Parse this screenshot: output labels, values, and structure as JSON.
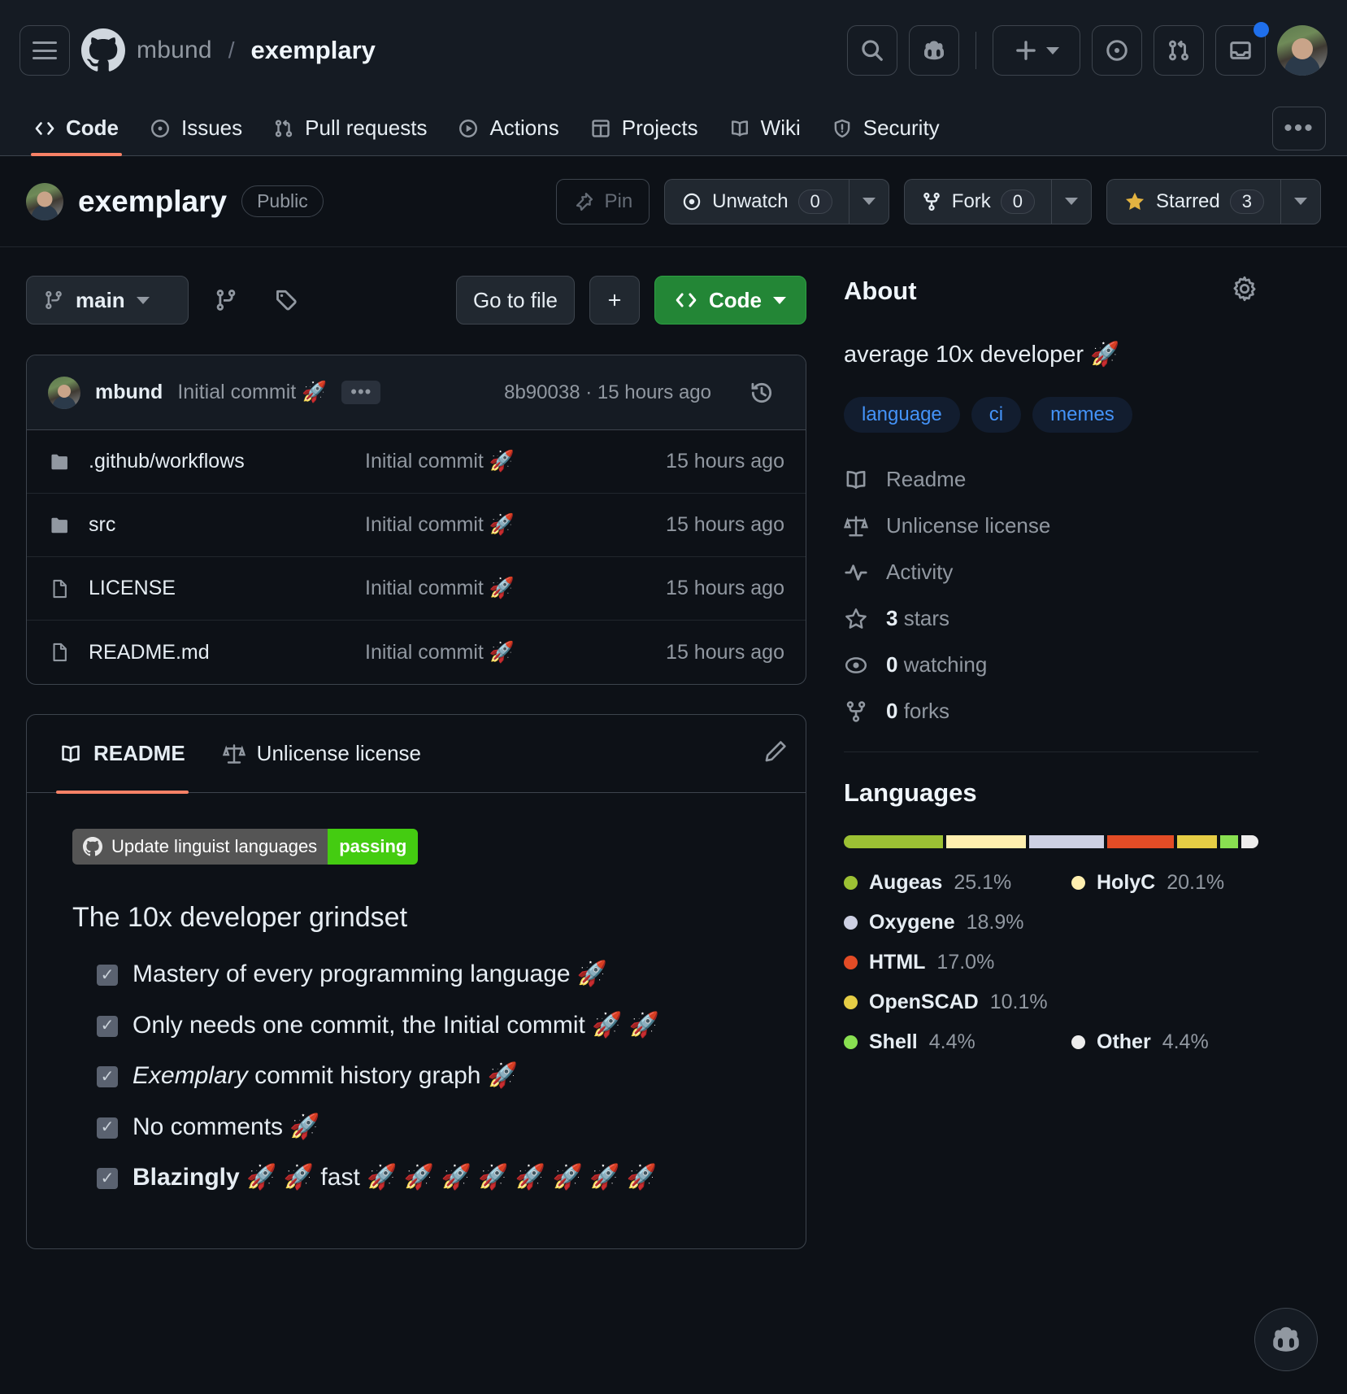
{
  "header": {
    "owner": "mbund",
    "separator": "/",
    "repo": "exemplary",
    "icons": [
      "menu-icon",
      "github-logo",
      "search-icon",
      "copilot-icon",
      "plus-icon",
      "chevron-down-icon",
      "issues-icon",
      "pull-requests-icon",
      "inbox-icon",
      "avatar"
    ]
  },
  "nav": {
    "tabs": [
      {
        "label": "Code",
        "icon": "code-icon",
        "active": true
      },
      {
        "label": "Issues",
        "icon": "issue-opened-icon",
        "active": false
      },
      {
        "label": "Pull requests",
        "icon": "git-pull-request-icon",
        "active": false
      },
      {
        "label": "Actions",
        "icon": "play-icon",
        "active": false
      },
      {
        "label": "Projects",
        "icon": "table-icon",
        "active": false
      },
      {
        "label": "Wiki",
        "icon": "book-icon",
        "active": false
      },
      {
        "label": "Security",
        "icon": "shield-icon",
        "active": false
      }
    ],
    "overflow_label": "•••"
  },
  "repo_header": {
    "name": "exemplary",
    "visibility": "Public",
    "pin_label": "Pin",
    "watch_label": "Unwatch",
    "watch_count": "0",
    "fork_label": "Fork",
    "fork_count": "0",
    "star_label": "Starred",
    "star_count": "3"
  },
  "toolbar": {
    "branch": "main",
    "go_to_file": "Go to file",
    "add_file": "+",
    "code_button": "Code"
  },
  "commit": {
    "author": "mbund",
    "message": "Initial commit 🚀",
    "dots": "•••",
    "hash": "8b90038",
    "separator": "·",
    "time": "15 hours ago"
  },
  "files": [
    {
      "name": ".github/workflows",
      "type": "folder",
      "message": "Initial commit 🚀",
      "time": "15 hours ago"
    },
    {
      "name": "src",
      "type": "folder",
      "message": "Initial commit 🚀",
      "time": "15 hours ago"
    },
    {
      "name": "LICENSE",
      "type": "file",
      "message": "Initial commit 🚀",
      "time": "15 hours ago"
    },
    {
      "name": "README.md",
      "type": "file",
      "message": "Initial commit 🚀",
      "time": "15 hours ago"
    }
  ],
  "readme": {
    "tabs": [
      {
        "label": "README",
        "icon": "book-icon",
        "active": true
      },
      {
        "label": "Unlicense license",
        "icon": "law-icon",
        "active": false
      }
    ],
    "edit_icon": "pencil-icon",
    "badge": {
      "left": "Update linguist languages",
      "right": "passing",
      "left_color": "#555555",
      "right_color": "#44cc11"
    },
    "heading": "The 10x developer grindset",
    "tasks": [
      {
        "checked": true,
        "text": "Mastery of every programming language 🚀"
      },
      {
        "checked": true,
        "text": "Only needs one commit, the Initial commit 🚀 🚀"
      },
      {
        "checked": true,
        "text": "commit history graph 🚀",
        "italic_prefix": "Exemplary"
      },
      {
        "checked": true,
        "text": "No comments 🚀"
      },
      {
        "checked": true,
        "text": "fast 🚀 🚀 🚀 🚀 🚀 🚀 🚀 🚀",
        "bold_prefix": "Blazingly 🚀 🚀"
      }
    ]
  },
  "about": {
    "title": "About",
    "settings_icon": "gear-icon",
    "description": "average 10x developer 🚀",
    "topics": [
      "language",
      "ci",
      "memes"
    ],
    "links": [
      {
        "label": "Readme",
        "icon": "book-icon"
      },
      {
        "label": "Unlicense license",
        "icon": "law-icon"
      },
      {
        "label": "Activity",
        "icon": "pulse-icon"
      },
      {
        "label": "3 stars",
        "icon": "star-icon",
        "value": "3",
        "suffix": "stars"
      },
      {
        "label": "0 watching",
        "icon": "eye-icon",
        "value": "0",
        "suffix": "watching"
      },
      {
        "label": "0 forks",
        "icon": "fork-icon",
        "value": "0",
        "suffix": "forks"
      }
    ]
  },
  "languages": {
    "title": "Languages",
    "items": [
      {
        "name": "Augeas",
        "pct": "25.1%",
        "value": 25.1,
        "color": "#9CC134"
      },
      {
        "name": "HolyC",
        "pct": "20.1%",
        "value": 20.1,
        "color": "#FFEFAF"
      },
      {
        "name": "Oxygene",
        "pct": "18.9%",
        "value": 18.9,
        "color": "#CDD0E3"
      },
      {
        "name": "HTML",
        "pct": "17.0%",
        "value": 17.0,
        "color": "#E34C26"
      },
      {
        "name": "OpenSCAD",
        "pct": "10.1%",
        "value": 10.1,
        "color": "#E5CD45"
      },
      {
        "name": "Shell",
        "pct": "4.4%",
        "value": 4.4,
        "color": "#89E051"
      },
      {
        "name": "Other",
        "pct": "4.4%",
        "value": 4.4,
        "color": "#EDEDED"
      }
    ]
  },
  "fab": {
    "icon": "copilot-icon"
  }
}
